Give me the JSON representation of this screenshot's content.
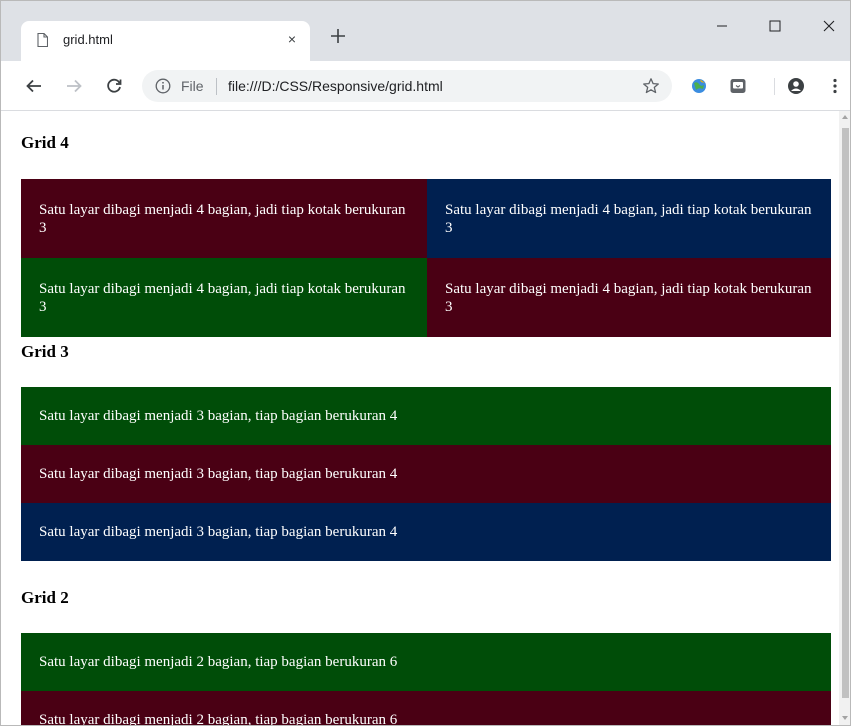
{
  "browser": {
    "tab_title": "grid.html",
    "tab_close": "×",
    "url_scheme": "File",
    "url": "file:///D:/CSS/Responsive/grid.html"
  },
  "colors": {
    "maroon": "#4a0014",
    "navy": "#002050",
    "green": "#004d08"
  },
  "page": {
    "grid4": {
      "heading": "Grid 4",
      "rows": [
        [
          {
            "text": "Satu layar dibagi menjadi 4 bagian, jadi tiap kotak berukuran 3",
            "color": "maroon"
          },
          {
            "text": "Satu layar dibagi menjadi 4 bagian, jadi tiap kotak berukuran 3",
            "color": "navy"
          }
        ],
        [
          {
            "text": "Satu layar dibagi menjadi 4 bagian, jadi tiap kotak berukuran 3",
            "color": "green"
          },
          {
            "text": "Satu layar dibagi menjadi 4 bagian, jadi tiap kotak berukuran 3",
            "color": "maroon"
          }
        ]
      ]
    },
    "grid3": {
      "heading": "Grid 3",
      "rows": [
        {
          "text": "Satu layar dibagi menjadi 3 bagian, tiap bagian berukuran 4",
          "color": "green"
        },
        {
          "text": "Satu layar dibagi menjadi 3 bagian, tiap bagian berukuran 4",
          "color": "maroon"
        },
        {
          "text": "Satu layar dibagi menjadi 3 bagian, tiap bagian berukuran 4",
          "color": "navy"
        }
      ]
    },
    "grid2": {
      "heading": "Grid 2",
      "rows": [
        {
          "text": "Satu layar dibagi menjadi 2 bagian, tiap bagian berukuran 6",
          "color": "green"
        },
        {
          "text": "Satu layar dibagi menjadi 2 bagian, tiap bagian berukuran 6",
          "color": "maroon"
        }
      ]
    }
  }
}
